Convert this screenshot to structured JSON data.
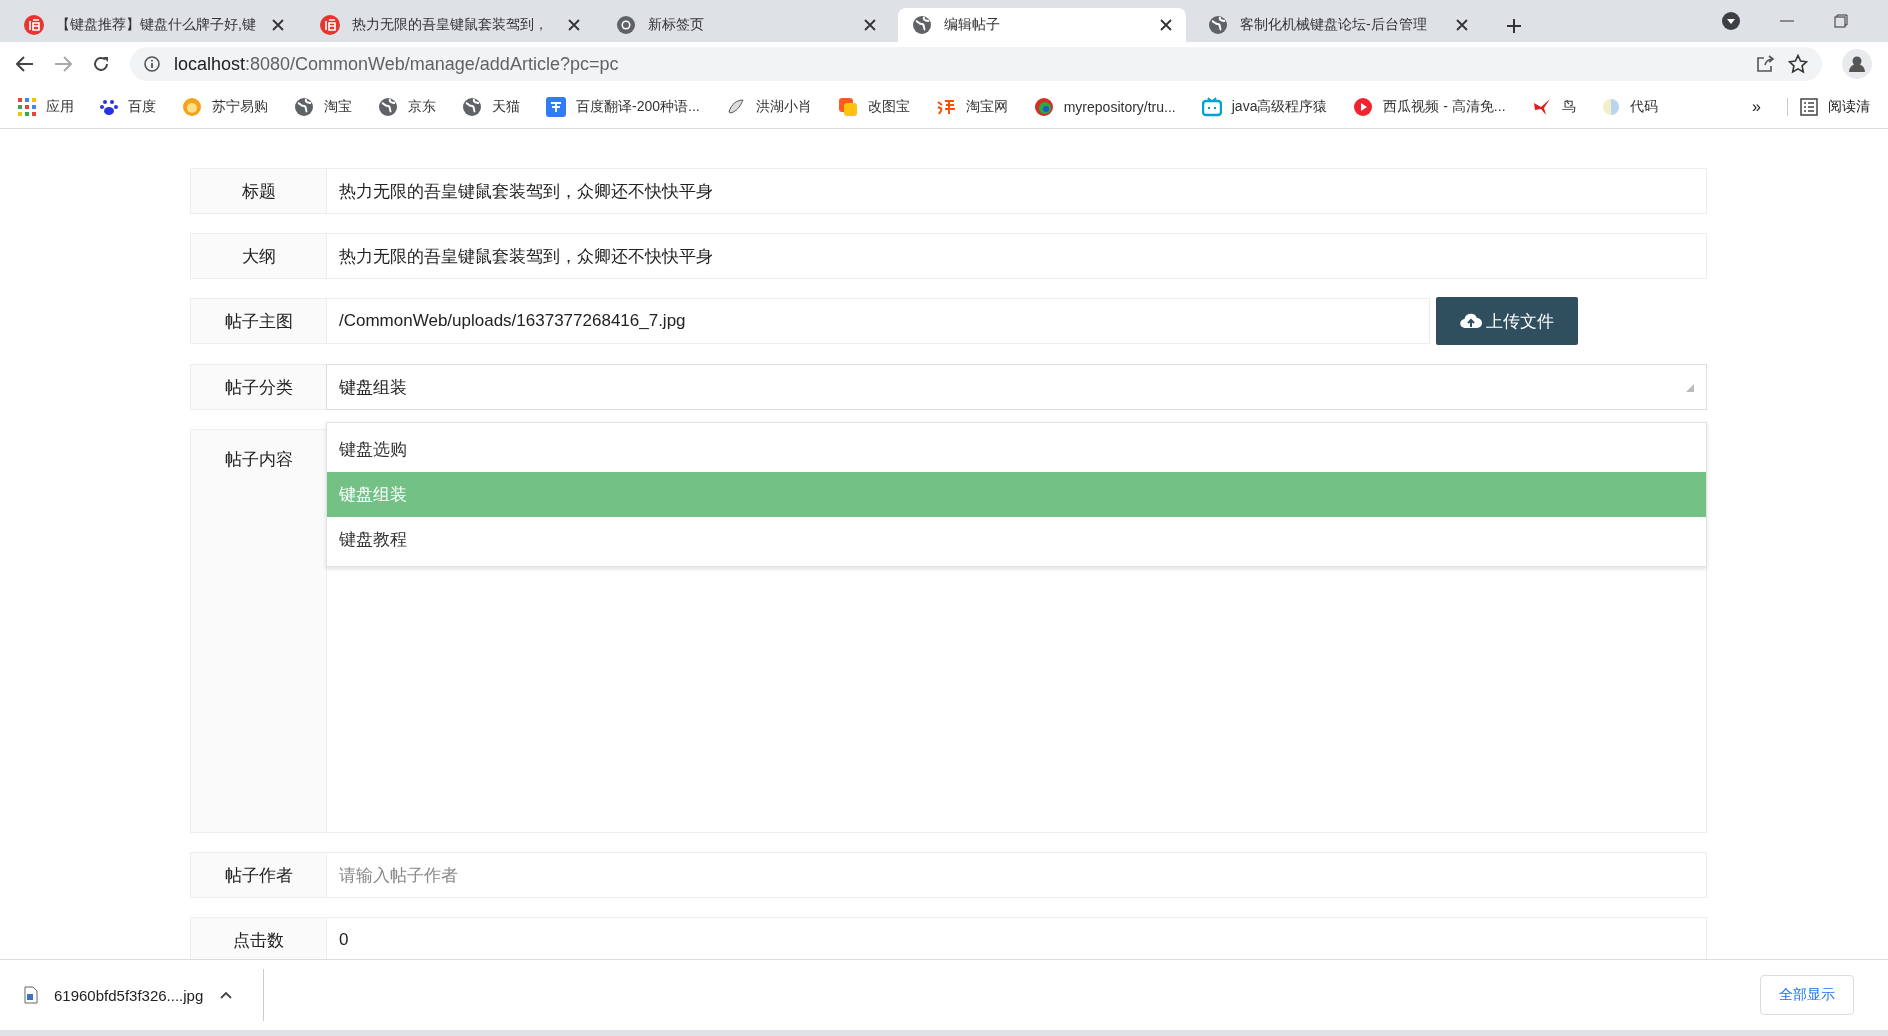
{
  "tabs": [
    {
      "title": "【键盘推荐】键盘什么牌子好,键",
      "selected": false
    },
    {
      "title": "热力无限的吾皇键鼠套装驾到，",
      "selected": false
    },
    {
      "title": "新标签页",
      "selected": false
    },
    {
      "title": "编辑帖子",
      "selected": true
    },
    {
      "title": "客制化机械键盘论坛-后台管理",
      "selected": false
    }
  ],
  "address": {
    "host": "localhost",
    "rest": ":8080/CommonWeb/manage/addArticle?pc=pc"
  },
  "bookmarks": [
    {
      "label": "应用"
    },
    {
      "label": "百度"
    },
    {
      "label": "苏宁易购"
    },
    {
      "label": "淘宝"
    },
    {
      "label": "京东"
    },
    {
      "label": "天猫"
    },
    {
      "label": "百度翻译-200种语..."
    },
    {
      "label": "洪湖小肖"
    },
    {
      "label": "改图宝"
    },
    {
      "label": "淘宝网"
    },
    {
      "label": "myrepository/tru..."
    },
    {
      "label": "java高级程序猿"
    },
    {
      "label": "西瓜视频 - 高清免..."
    },
    {
      "label": "鸟"
    },
    {
      "label": "代码"
    }
  ],
  "bookmarks_more": "»",
  "reading_list": "阅读清",
  "form": [
    {
      "kind": "text",
      "label": "标题",
      "value": "热力无限的吾皇键鼠套装驾到，众卿还不快快平身"
    },
    {
      "kind": "text",
      "label": "大纲",
      "value": "热力无限的吾皇键鼠套装驾到，众卿还不快快平身"
    },
    {
      "kind": "upload",
      "label": "帖子主图",
      "value": "/CommonWeb/uploads/1637377268416_7.jpg",
      "button": "上传文件"
    },
    {
      "kind": "select",
      "label": "帖子分类",
      "value": "键盘组装",
      "expanded": true,
      "options": [
        {
          "label": "键盘选购",
          "selected": false
        },
        {
          "label": "键盘组装",
          "selected": true
        },
        {
          "label": "键盘教程",
          "selected": false
        }
      ]
    },
    {
      "kind": "editor",
      "label": "帖子内容"
    },
    {
      "kind": "text",
      "label": "帖子作者",
      "placeholder": "请输入帖子作者"
    },
    {
      "kind": "text",
      "label": "点击数",
      "value": "0"
    }
  ],
  "download": {
    "file": "61960bfd5f3f326....jpg",
    "show_all": "全部显示"
  }
}
